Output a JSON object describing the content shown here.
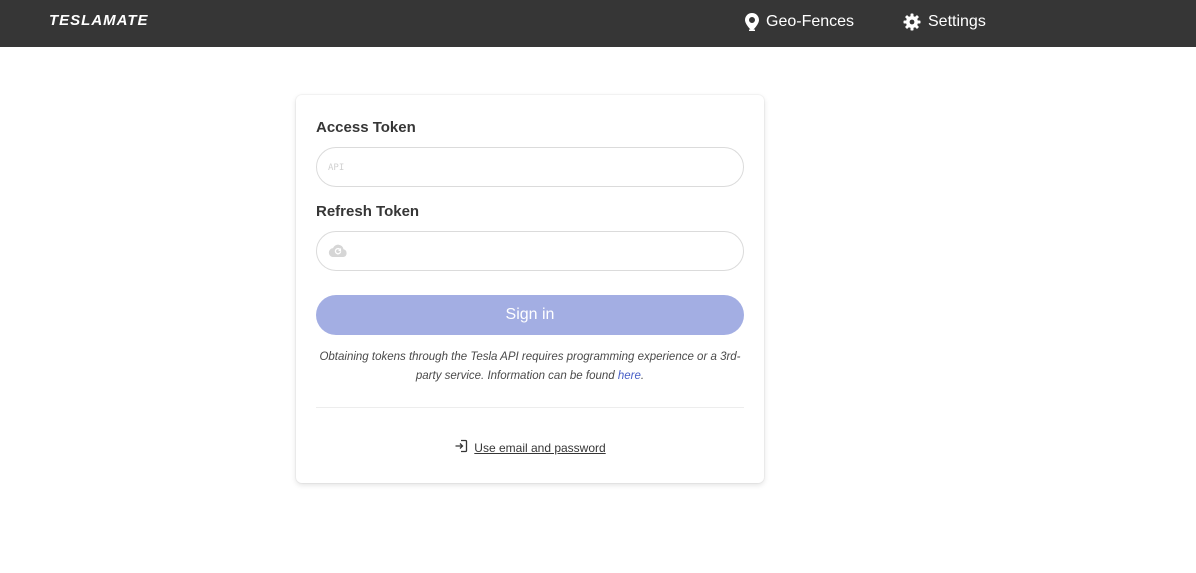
{
  "navbar": {
    "brand": "TESLAMATE",
    "items": [
      {
        "label": "Geo-Fences",
        "icon": "map-marker-icon"
      },
      {
        "label": "Settings",
        "icon": "gear-icon"
      }
    ]
  },
  "form": {
    "access_token_label": "Access Token",
    "access_token_icon_text": "API",
    "access_token_value": "",
    "refresh_token_label": "Refresh Token",
    "refresh_token_value": "",
    "refresh_token_icon": "cloud-refresh-icon",
    "signin_label": "Sign in",
    "hint_text": "Obtaining tokens through the Tesla API requires programming experience or a 3rd-party service. Information can be found ",
    "hint_link": "here",
    "hint_end": ".",
    "alt_link_label": "Use email and password",
    "alt_link_icon": "sign-in-icon"
  },
  "colors": {
    "navbar_bg": "#363636",
    "signin_button": "#a3aee3",
    "link": "#485fc7"
  }
}
